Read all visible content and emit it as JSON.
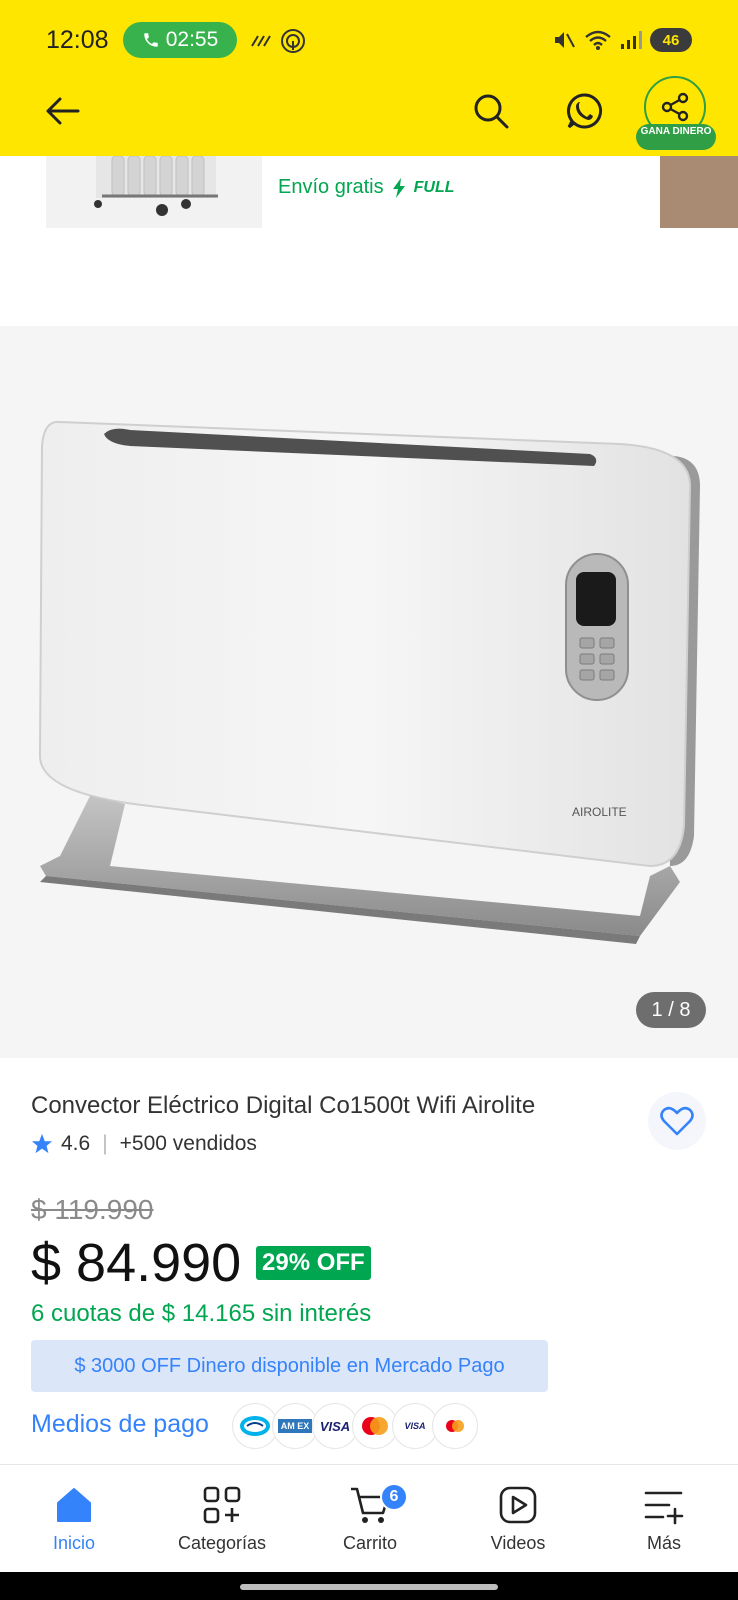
{
  "status_bar": {
    "time": "12:08",
    "call_timer": "02:55",
    "battery": "46"
  },
  "header": {
    "share_badge": "GANA DINERO"
  },
  "recommendation": {
    "shipping": "Envío gratis",
    "full_label": "FULL"
  },
  "gallery": {
    "counter": "1 / 8",
    "brand_on_product": "AIROLITE"
  },
  "product": {
    "title": "Convector Eléctrico Digital Co1500t Wifi Airolite",
    "rating": "4.6",
    "sold": "+500 vendidos",
    "old_price": "$ 119.990",
    "price": "$ 84.990",
    "discount": "29% OFF",
    "installments": "6 cuotas de $ 14.165 sin interés",
    "promo_banner": "$ 3000 OFF Dinero disponible en Mercado Pago",
    "payment_methods_label": "Medios de pago",
    "payment_icons": [
      "mercadopago-icon",
      "amex-icon",
      "visa-icon",
      "mastercard-icon",
      "visa-debit-icon",
      "maestro-icon"
    ],
    "visa_text": "VISA",
    "amex_text": "AM EX"
  },
  "tabbar": {
    "tabs": [
      {
        "label": "Inicio"
      },
      {
        "label": "Categorías"
      },
      {
        "label": "Carrito",
        "badge": "6"
      },
      {
        "label": "Videos"
      },
      {
        "label": "Más"
      }
    ]
  },
  "colors": {
    "brand_yellow": "#ffe600",
    "accent_blue": "#3483fa",
    "green": "#00a650"
  }
}
